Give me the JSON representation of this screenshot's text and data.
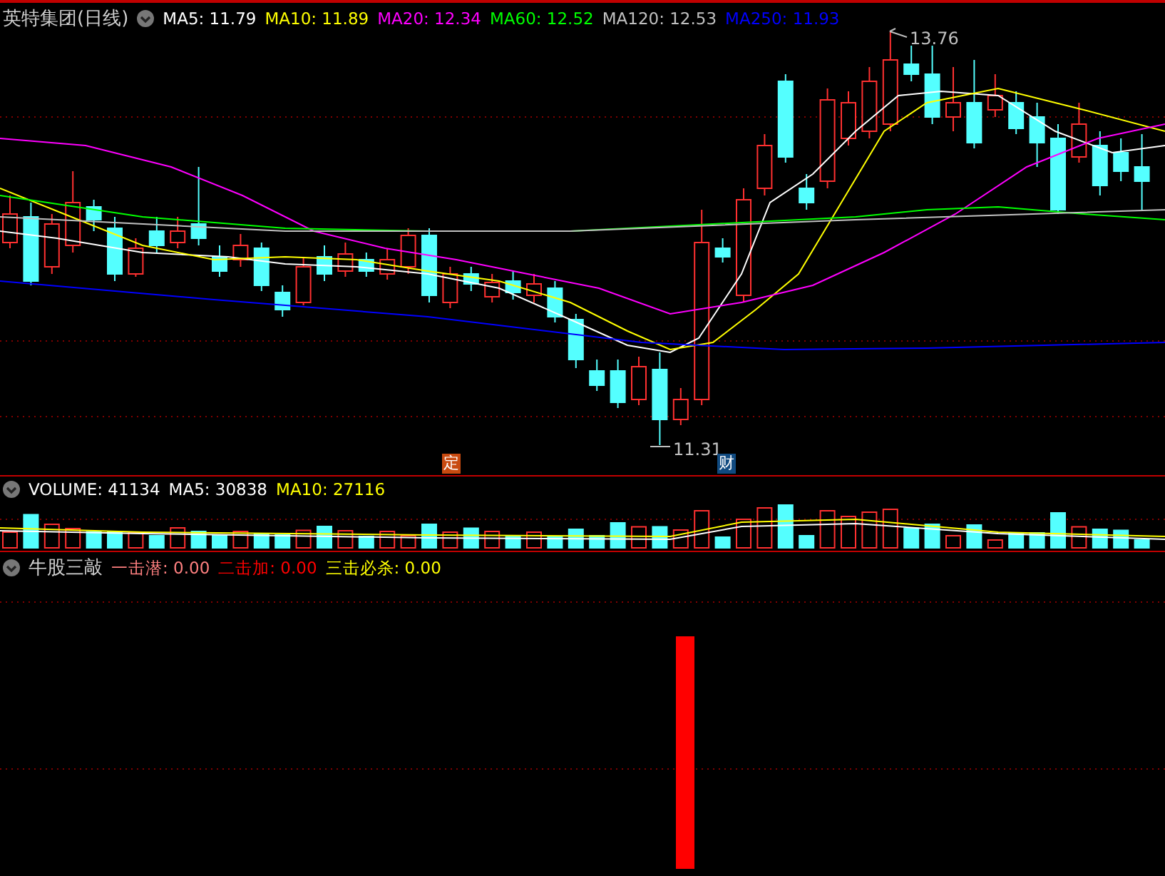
{
  "main_panel": {
    "title": "英特集团(日线)",
    "indicators": [
      {
        "label": "MA5: 11.79",
        "color": "#ffffff"
      },
      {
        "label": "MA10: 11.89",
        "color": "#ffff00"
      },
      {
        "label": "MA20: 12.34",
        "color": "#ff00ff"
      },
      {
        "label": "MA60: 12.52",
        "color": "#00ff00"
      },
      {
        "label": "MA120: 12.53",
        "color": "#c0c0c0"
      },
      {
        "label": "MA250: 11.93",
        "color": "#0000ff"
      }
    ],
    "high_label": "13.76",
    "low_label": "11.31",
    "markers": [
      {
        "text": "定",
        "color": "#c84a10"
      },
      {
        "text": "财",
        "color": "#104a80"
      }
    ]
  },
  "volume_panel": {
    "indicators": [
      {
        "label": "VOLUME: 41134",
        "color": "#ffffff"
      },
      {
        "label": "MA5: 30838",
        "color": "#ffffff"
      },
      {
        "label": "MA10: 27116",
        "color": "#ffff00"
      }
    ]
  },
  "signal_panel": {
    "title": "牛股三敲",
    "indicators": [
      {
        "label": "一击潜: 0.00",
        "color": "#ff8080"
      },
      {
        "label": "二击加: 0.00",
        "color": "#ff0000"
      },
      {
        "label": "三击必杀: 0.00",
        "color": "#ffff00"
      }
    ]
  }
}
